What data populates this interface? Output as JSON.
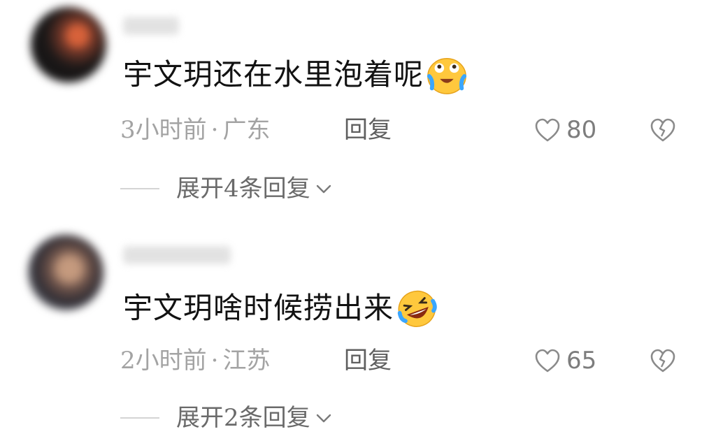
{
  "comments": [
    {
      "text": "宇文玥还在水里泡着呢",
      "emoji": "crying-laughing-face-icon",
      "time": "3小时前",
      "separator": "·",
      "location": "广东",
      "reply_label": "回复",
      "likes": "80",
      "expand_label": "展开4条回复"
    },
    {
      "text": "宇文玥啥时候捞出来",
      "emoji": "rolling-laughing-face-icon",
      "time": "2小时前",
      "separator": "·",
      "location": "江苏",
      "reply_label": "回复",
      "likes": "65",
      "expand_label": "展开2条回复"
    }
  ],
  "colors": {
    "text": "#121212",
    "meta": "#a3a3a3",
    "reply": "#5f5f5f",
    "icon": "#9a9a9a",
    "emoji_yellow": "#ffc83d",
    "emoji_tear": "#3aa6ff"
  }
}
